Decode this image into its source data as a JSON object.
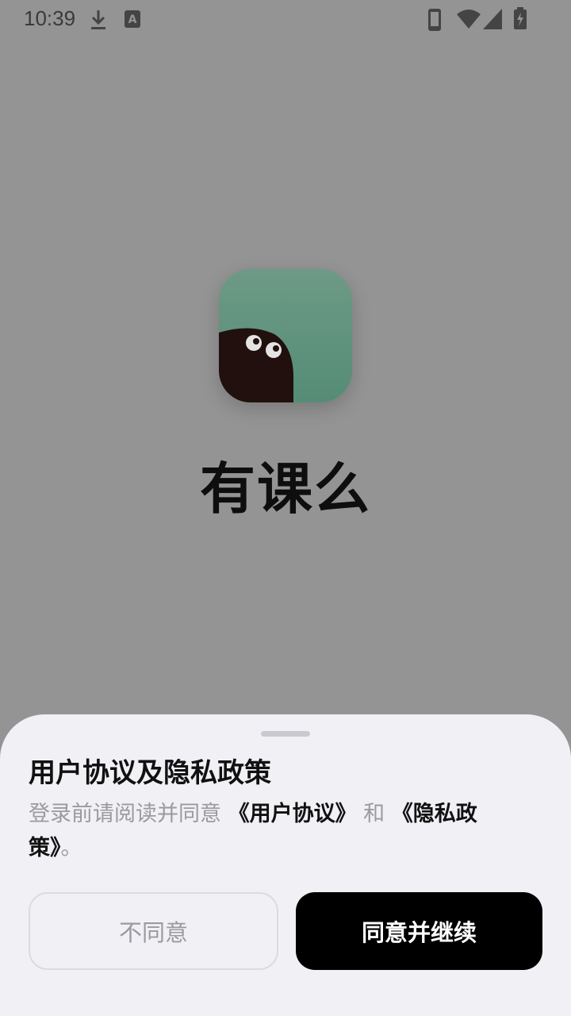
{
  "status_bar": {
    "time": "10:39",
    "icons": [
      "download-icon",
      "keyboard-a-icon",
      "phone-icon",
      "wifi-icon",
      "signal-icon",
      "battery-charging-icon"
    ]
  },
  "splash": {
    "app_name": "有课么",
    "icon": "app-logo-icon"
  },
  "sheet": {
    "title": "用户协议及隐私政策",
    "desc_prefix": "登录前请阅读并同意 ",
    "user_agreement_link": "《用户协议》",
    "desc_and": " 和 ",
    "privacy_policy_link": "《隐私政策》",
    "desc_suffix": "。",
    "decline_label": "不同意",
    "agree_label": "同意并继续"
  }
}
